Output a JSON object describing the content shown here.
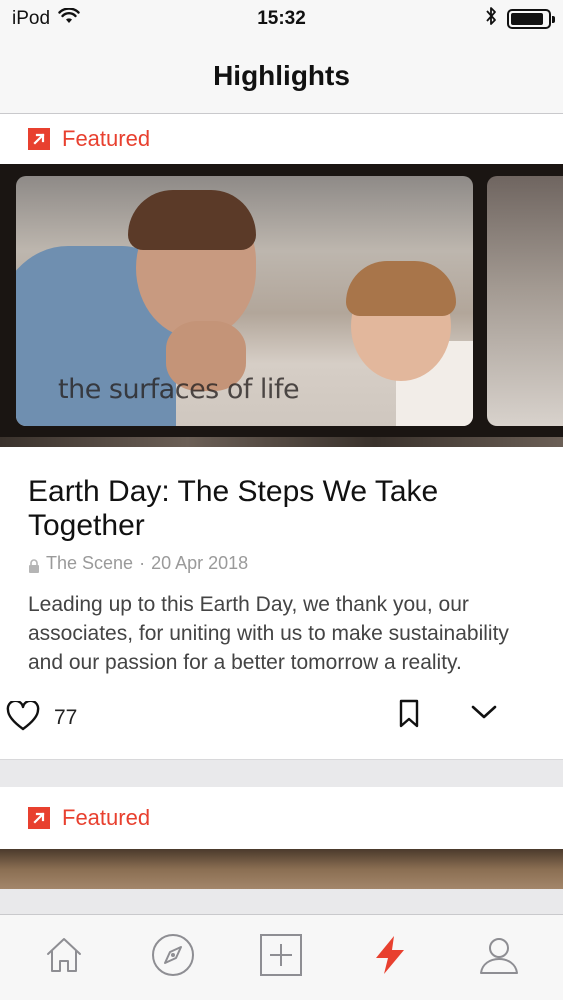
{
  "status_bar": {
    "carrier": "iPod",
    "time": "15:32",
    "battery_level": 0.9,
    "bluetooth_icon": "bluetooth-icon",
    "wifi_icon": "wifi-icon"
  },
  "nav": {
    "title": "Highlights"
  },
  "feed": {
    "cards": [
      {
        "badge": "Featured",
        "badge_icon": "arrow-up-right-icon",
        "hero_caption": "the surfaces of life",
        "title": "Earth Day: The Steps We Take Together",
        "source": "The Scene",
        "date": "20 Apr 2018",
        "separator": "·",
        "excerpt": "Leading up to this Earth Day, we thank you, our associates, for uniting with us to make sustainability and our passion for a better tomorrow a reality.",
        "likes": "77"
      },
      {
        "badge": "Featured",
        "badge_icon": "arrow-up-right-icon"
      }
    ]
  },
  "tab_bar": {
    "tabs": [
      {
        "icon": "home-icon",
        "active": false
      },
      {
        "icon": "compass-icon",
        "active": false
      },
      {
        "icon": "add-icon",
        "active": false
      },
      {
        "icon": "lightning-icon",
        "active": true
      },
      {
        "icon": "profile-icon",
        "active": false
      }
    ]
  },
  "colors": {
    "accent": "#e8402f",
    "inactive_icon": "#8e8e93",
    "text": "#111111",
    "meta_text": "#9a9a9a"
  }
}
